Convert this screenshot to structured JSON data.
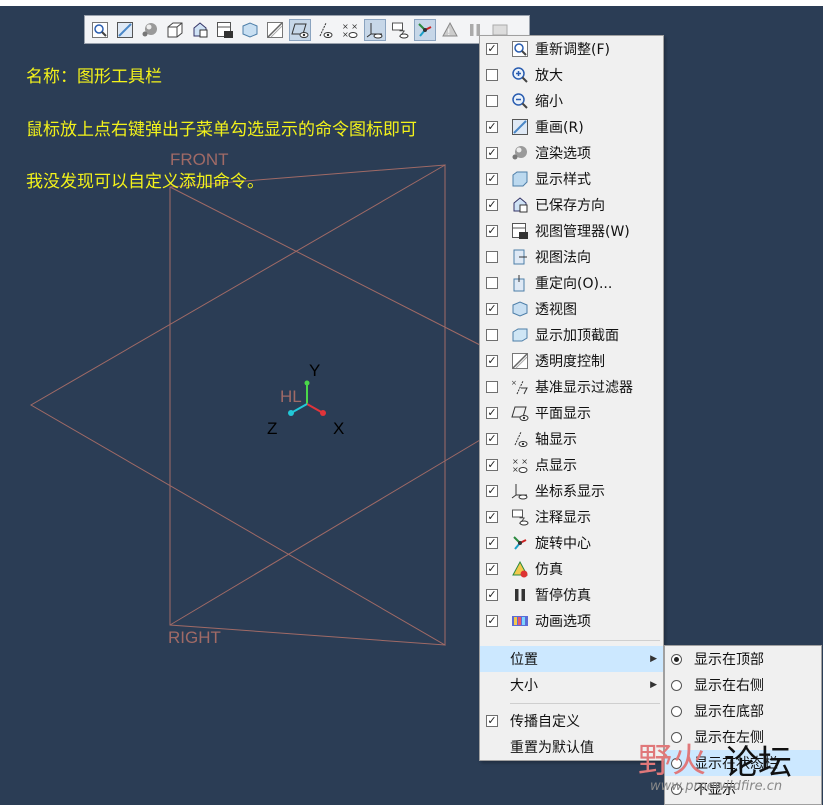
{
  "toolbar": {
    "buttons": [
      {
        "icon": "zoom-fit-icon"
      },
      {
        "icon": "repaint-icon"
      },
      {
        "icon": "render-options-icon"
      },
      {
        "icon": "display-style-icon"
      },
      {
        "icon": "saved-orientation-icon"
      },
      {
        "icon": "view-manager-icon"
      },
      {
        "icon": "perspective-icon"
      },
      {
        "icon": "transparency-icon"
      },
      {
        "icon": "plane-display-icon"
      },
      {
        "icon": "axis-display-icon"
      },
      {
        "icon": "point-display-icon"
      },
      {
        "icon": "csys-display-icon"
      },
      {
        "icon": "annotation-display-icon"
      },
      {
        "icon": "spin-center-icon"
      },
      {
        "icon": "simulation-icon"
      },
      {
        "icon": "pause-icon"
      },
      {
        "icon": "animation-icon"
      }
    ]
  },
  "notes": {
    "line1": "名称：图形工具栏",
    "line2": "鼠标放上点右键弹出子菜单勾选显示的命令图标即可",
    "line3": "我没发现可以自定义添加命令。"
  },
  "viewport": {
    "front_label": "FRONT",
    "right_label": "RIGHT",
    "csys_name": "HL",
    "axis_x": "X",
    "axis_y": "Y",
    "axis_z": "Z"
  },
  "menu": {
    "items": [
      {
        "label": "重新调整(F)",
        "checked": true,
        "icon": "zoom-fit-icon"
      },
      {
        "label": "放大",
        "checked": false,
        "icon": "zoom-in-icon"
      },
      {
        "label": "缩小",
        "checked": false,
        "icon": "zoom-out-icon"
      },
      {
        "label": "重画(R)",
        "checked": true,
        "icon": "repaint-icon"
      },
      {
        "label": "渲染选项",
        "checked": true,
        "icon": "render-options-icon"
      },
      {
        "label": "显示样式",
        "checked": true,
        "icon": "display-style-icon"
      },
      {
        "label": "已保存方向",
        "checked": true,
        "icon": "saved-orientation-icon"
      },
      {
        "label": "视图管理器(W)",
        "checked": true,
        "icon": "view-manager-icon"
      },
      {
        "label": "视图法向",
        "checked": false,
        "icon": "view-normal-icon"
      },
      {
        "label": "重定向(O)...",
        "checked": false,
        "icon": "reorient-icon"
      },
      {
        "label": "透视图",
        "checked": true,
        "icon": "perspective-icon"
      },
      {
        "label": "显示加顶截面",
        "checked": false,
        "icon": "capped-section-icon"
      },
      {
        "label": "透明度控制",
        "checked": true,
        "icon": "transparency-icon"
      },
      {
        "label": "基准显示过滤器",
        "checked": false,
        "icon": "datum-filter-icon"
      },
      {
        "label": "平面显示",
        "checked": true,
        "icon": "plane-display-icon"
      },
      {
        "label": "轴显示",
        "checked": true,
        "icon": "axis-display-icon"
      },
      {
        "label": "点显示",
        "checked": true,
        "icon": "point-display-icon"
      },
      {
        "label": "坐标系显示",
        "checked": true,
        "icon": "csys-display-icon"
      },
      {
        "label": "注释显示",
        "checked": true,
        "icon": "annotation-display-icon"
      },
      {
        "label": "旋转中心",
        "checked": true,
        "icon": "spin-center-icon"
      },
      {
        "label": "仿真",
        "checked": true,
        "icon": "simulation-icon"
      },
      {
        "label": "暂停仿真",
        "checked": true,
        "icon": "pause-icon"
      },
      {
        "label": "动画选项",
        "checked": true,
        "icon": "animation-icon"
      }
    ],
    "position_label": "位置",
    "size_label": "大小",
    "propagate_label": "传播自定义",
    "propagate_checked": true,
    "reset_label": "重置为默认值"
  },
  "submenu": {
    "items": [
      {
        "label": "显示在顶部",
        "selected": true
      },
      {
        "label": "显示在右侧",
        "selected": false
      },
      {
        "label": "显示在底部",
        "selected": false
      },
      {
        "label": "显示在左侧",
        "selected": false
      },
      {
        "label": "显示在状态栏",
        "selected": false
      },
      {
        "label": "不显示",
        "selected": false
      }
    ]
  },
  "watermark": {
    "big_left": "野火",
    "big_right": "论坛",
    "url": "www.proewildfire.cn"
  },
  "colors": {
    "background": "#2b3d55",
    "note_text": "#f3f21a",
    "datum_lines": "#a06a66",
    "menu_bg": "#f0f0f0",
    "highlight": "#cce8ff"
  }
}
